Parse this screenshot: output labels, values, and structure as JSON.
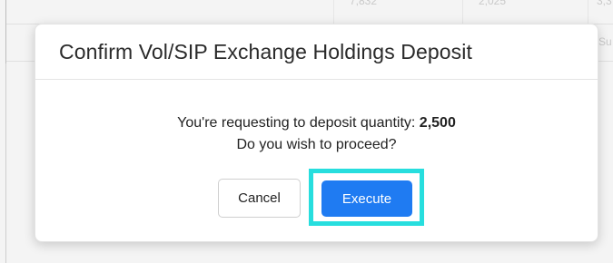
{
  "background": {
    "faint_values": [
      "7,832",
      "2,025",
      "3,3",
      "Su"
    ]
  },
  "modal": {
    "title": "Confirm Vol/SIP Exchange Holdings Deposit",
    "message_prefix": "You're requesting to deposit quantity: ",
    "quantity": "2,500",
    "question": "Do you wish to proceed?",
    "cancel_label": "Cancel",
    "execute_label": "Execute"
  },
  "colors": {
    "primary": "#1f7bf2",
    "highlight": "#27dede"
  }
}
